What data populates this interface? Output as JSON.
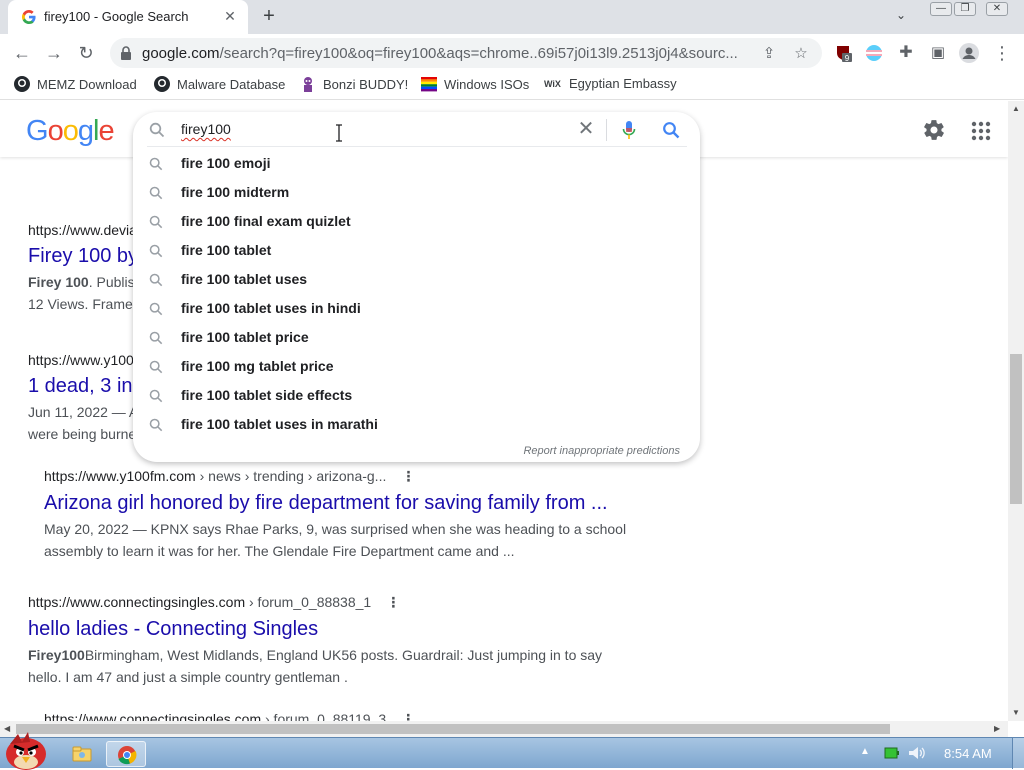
{
  "tab": {
    "title": "firey100 - Google Search"
  },
  "toolbar": {
    "url_host": "google.com",
    "url_rest": "/search?q=firey100&oq=firey100&aqs=chrome..69i57j0i13l9.2513j0j4&sourc..."
  },
  "bookmarks": [
    {
      "label": "MEMZ Download",
      "icon": "github-icon"
    },
    {
      "label": "Malware Database",
      "icon": "github-icon"
    },
    {
      "label": "Bonzi BUDDY!",
      "icon": "bonzi-icon"
    },
    {
      "label": "Windows ISOs",
      "icon": "rainbow-flag-icon"
    },
    {
      "label": "Egyptian Embassy",
      "icon": "wix-icon"
    }
  ],
  "google": {
    "logo": [
      "G",
      "o",
      "o",
      "g",
      "l",
      "e"
    ],
    "logo_colors": [
      "#4285f4",
      "#ea4335",
      "#fbbc05",
      "#4285f4",
      "#34a853",
      "#ea4335"
    ]
  },
  "search": {
    "query": "firey100",
    "suggestions": [
      "fire 100 emoji",
      "fire 100 midterm",
      "fire 100 final exam quizlet",
      "fire 100 tablet",
      "fire 100 tablet uses",
      "fire 100 tablet uses in hindi",
      "fire 100 tablet price",
      "fire 100 mg tablet price",
      "fire 100 tablet side effects",
      "fire 100 tablet uses in marathi"
    ],
    "report": "Report inappropriate predictions"
  },
  "results": [
    {
      "url": "https://www.devia",
      "title": "Firey 100 by",
      "snippet_bold": "Firey 100",
      "snippet_line1": ". Publis",
      "snippet_line2": "12 Views. Frame"
    },
    {
      "url": "https://www.y100",
      "title": "1 dead, 3 in",
      "snippet_line1": "Jun 11, 2022 — A",
      "snippet_line2": "were being burne"
    },
    {
      "url": "https://www.y100fm.com",
      "crumbs": " › news › trending › arizona-g...",
      "title": "Arizona girl honored by fire department for saving family from ...",
      "snippet_line1": "May 20, 2022 — KPNX says Rhae Parks, 9, was surprised when she was heading to a school",
      "snippet_line2": "assembly to learn it was for her. The Glendale Fire Department came and ..."
    },
    {
      "url": "https://www.connectingsingles.com",
      "crumbs": " › forum_0_88838_1",
      "title": "hello ladies - Connecting Singles",
      "snippet_bold": "Firey100",
      "snippet_line1": "Birmingham, West Midlands, England UK56 posts. Guardrail: Just jumping in to say",
      "snippet_line2": "hello. I am 47 and just a simple country gentleman ."
    },
    {
      "url": "https://www.connectingsingles.com",
      "crumbs": " › forum_0_88119_3"
    }
  ],
  "taskbar": {
    "clock": "8:54 AM"
  }
}
